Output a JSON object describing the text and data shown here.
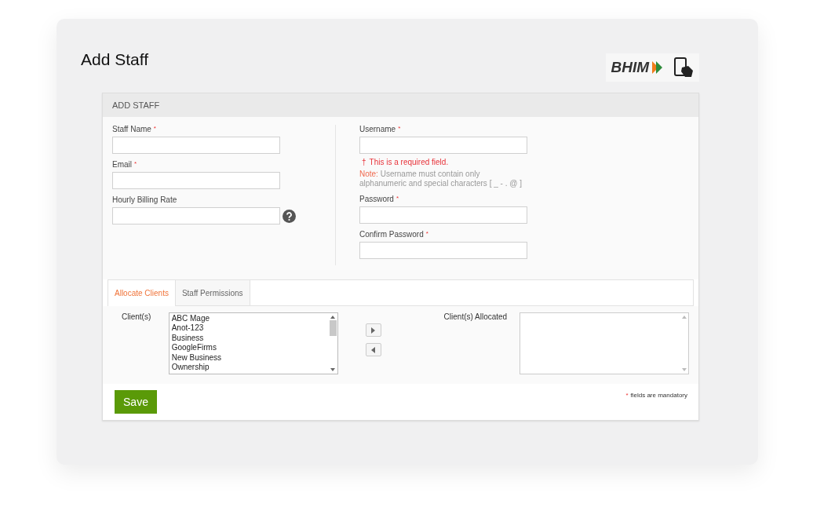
{
  "page_title": "Add Staff",
  "logo": {
    "text": "BHIM"
  },
  "panel": {
    "title": "ADD STAFF",
    "left_fields": [
      {
        "label": "Staff Name",
        "mark": "*",
        "help": false
      },
      {
        "label": "Email",
        "mark": "*",
        "help": false
      },
      {
        "label": "Hourly Billing Rate",
        "help": true
      }
    ],
    "right_fields": [
      {
        "label": "Username",
        "mark": "*",
        "error": {
          "icon": "†",
          "text": "This is a required field."
        },
        "note": {
          "label": "Note:",
          "text": "Username must contain only alphanumeric and special characters [ _ - . @ ]"
        }
      },
      {
        "label": "Password",
        "mark": "*"
      },
      {
        "label": "Confirm Password",
        "mark": "*"
      }
    ],
    "tabs": [
      {
        "label": "Allocate Clients",
        "selected": true
      },
      {
        "label": "Staff Permissions",
        "selected": false
      }
    ],
    "clients": {
      "label": "Client(s)",
      "items": [
        "ABC Mage",
        "Anot-123",
        "Business",
        "GoogleFirms",
        "New Business",
        "Ownership"
      ]
    },
    "allocated": {
      "label": "Client(s) Allocated"
    },
    "save": "Save",
    "mandatory": {
      "mark": "*",
      "text": "fields are mandatory"
    }
  }
}
